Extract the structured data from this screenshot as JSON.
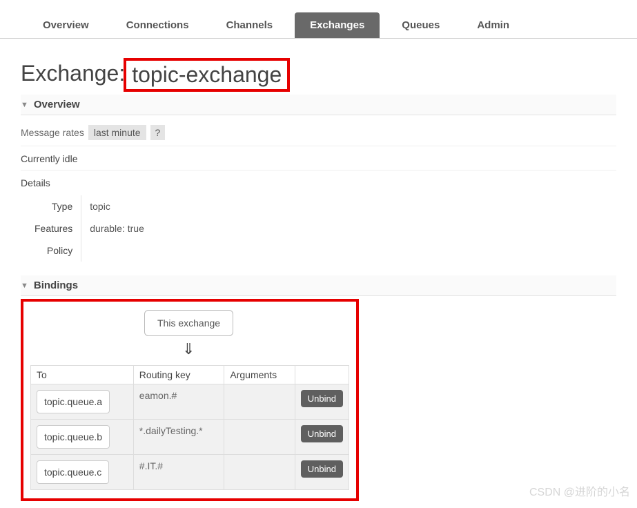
{
  "tabs": {
    "overview": "Overview",
    "connections": "Connections",
    "channels": "Channels",
    "exchanges": "Exchanges",
    "queues": "Queues",
    "admin": "Admin",
    "active": "exchanges"
  },
  "page": {
    "title_prefix": "Exchange:",
    "exchange_name": "topic-exchange"
  },
  "sections": {
    "overview": "Overview",
    "bindings": "Bindings"
  },
  "rates": {
    "label": "Message rates",
    "range": "last minute",
    "help": "?"
  },
  "status": {
    "idle": "Currently idle",
    "details": "Details"
  },
  "details": {
    "type_label": "Type",
    "type_value": "topic",
    "features_label": "Features",
    "features_value": "durable: true",
    "policy_label": "Policy",
    "policy_value": ""
  },
  "bindings": {
    "this_exchange": "This exchange",
    "arrow": "⇓",
    "headers": {
      "to": "To",
      "routing_key": "Routing key",
      "arguments": "Arguments"
    },
    "unbind_label": "Unbind",
    "rows": [
      {
        "to": "topic.queue.a",
        "routing_key": "eamon.#",
        "arguments": ""
      },
      {
        "to": "topic.queue.b",
        "routing_key": "*.dailyTesting.*",
        "arguments": ""
      },
      {
        "to": "topic.queue.c",
        "routing_key": "#.IT.#",
        "arguments": ""
      }
    ]
  },
  "watermark": "CSDN @进阶的小名"
}
